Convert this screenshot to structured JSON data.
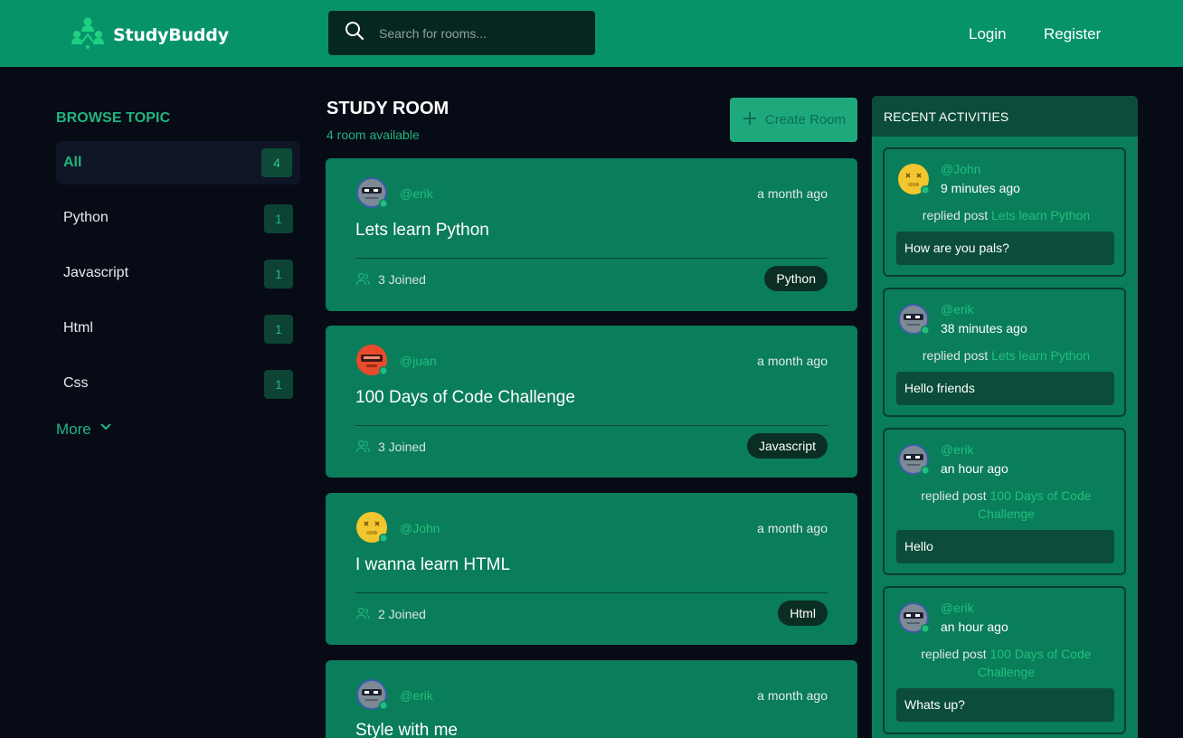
{
  "header": {
    "brand": "StudyBuddy",
    "search_placeholder": "Search for rooms...",
    "login": "Login",
    "register": "Register"
  },
  "sidebar": {
    "title": "BROWSE TOPIC",
    "topics": [
      {
        "name": "All",
        "count": "4"
      },
      {
        "name": "Python",
        "count": "1"
      },
      {
        "name": "Javascript",
        "count": "1"
      },
      {
        "name": "Html",
        "count": "1"
      },
      {
        "name": "Css",
        "count": "1"
      }
    ],
    "more": "More"
  },
  "main": {
    "title": "STUDY ROOM",
    "subtitle": "4 room available",
    "create_label": "Create Room",
    "rooms": [
      {
        "host": "@erik",
        "time": "a month ago",
        "title": "Lets learn Python",
        "joined": "3 Joined",
        "tag": "Python",
        "avatar": "robot-gray"
      },
      {
        "host": "@juan",
        "time": "a month ago",
        "title": "100 Days of Code Challenge",
        "joined": "3 Joined",
        "tag": "Javascript",
        "avatar": "robot-red"
      },
      {
        "host": "@John",
        "time": "a month ago",
        "title": "I wanna learn HTML",
        "joined": "2 Joined",
        "tag": "Html",
        "avatar": "face-yellow"
      },
      {
        "host": "@erik",
        "time": "a month ago",
        "title": "Style with me",
        "joined": "",
        "tag": "",
        "avatar": "robot-gray"
      }
    ]
  },
  "activity": {
    "title": "RECENT ACTIVITIES",
    "items": [
      {
        "user": "@John",
        "when": "9 minutes ago",
        "action": "replied post",
        "post": "Lets learn Python",
        "message": "How are you pals?",
        "avatar": "face-yellow"
      },
      {
        "user": "@erik",
        "when": "38 minutes ago",
        "action": "replied post",
        "post": "Lets learn Python",
        "message": "Hello friends",
        "avatar": "robot-gray"
      },
      {
        "user": "@erik",
        "when": "an hour ago",
        "action": "replied post",
        "post": "100 Days of Code Challenge",
        "message": "Hello",
        "avatar": "robot-gray"
      },
      {
        "user": "@erik",
        "when": "an hour ago",
        "action": "replied post",
        "post": "100 Days of Code Challenge",
        "message": "Whats up?",
        "avatar": "robot-gray"
      }
    ]
  },
  "colors": {
    "header_bg": "#07936a",
    "page_bg": "#070b16",
    "card_bg": "#0a7d5a",
    "accent": "#21b47f"
  }
}
